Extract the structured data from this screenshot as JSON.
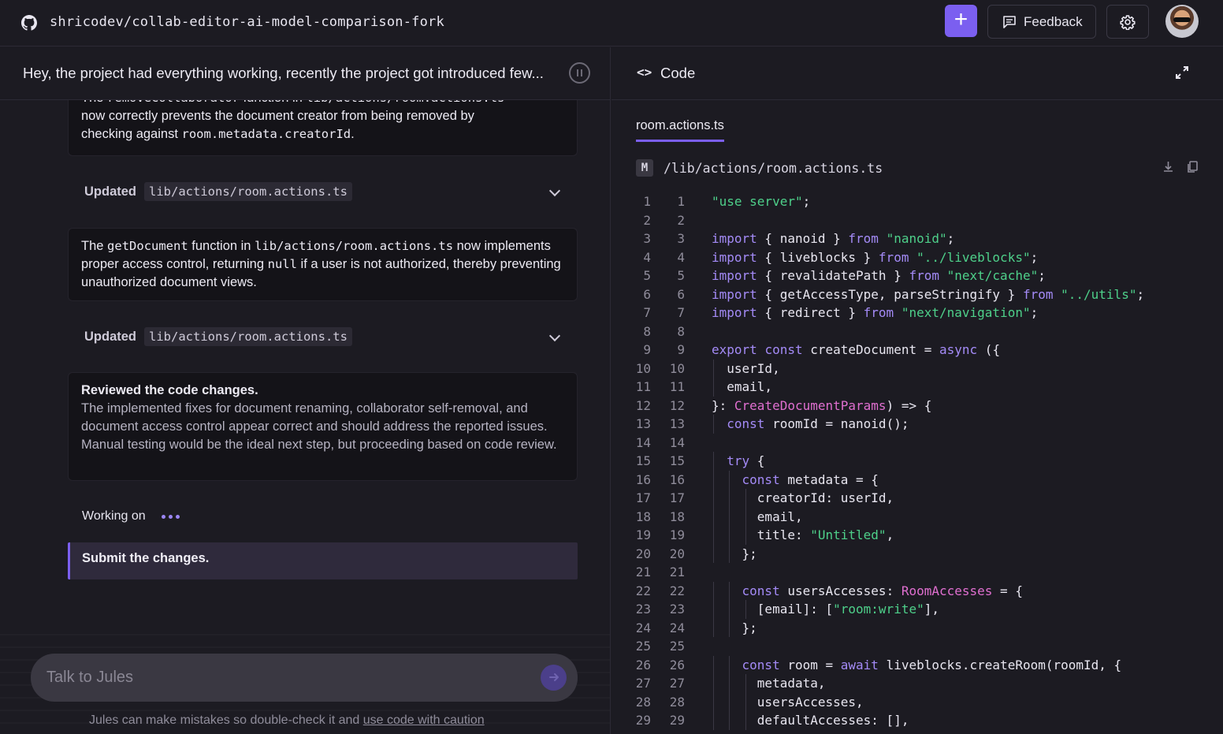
{
  "topbar": {
    "repo": "shricodev/collab-editor-ai-model-comparison-fork",
    "new_button_label": "+",
    "feedback_label": "Feedback"
  },
  "task": {
    "title": "Hey, the project had everything working, recently the project got introduced few..."
  },
  "messages": {
    "card1": {
      "line1_pre": "The ",
      "line1_code": "removeCollaborator",
      "line1_mid": " function in ",
      "line1_code2": "lib/actions/room.actions.ts",
      "line2": "now correctly prevents the document creator from being removed by",
      "line3_pre": "checking against ",
      "line3_code": "room.metadata.creatorId",
      "line3_post": "."
    },
    "updated1": {
      "label": "Updated",
      "file": "lib/actions/room.actions.ts"
    },
    "card2": {
      "pre": "The ",
      "code1": "getDocument",
      "mid": " function in ",
      "code2": "lib/actions/room.actions.ts",
      "post1": " now implements proper access control, returning ",
      "code3": "null",
      "post2": " if a user is not authorized, thereby preventing unauthorized document views."
    },
    "updated2": {
      "label": "Updated",
      "file": "lib/actions/room.actions.ts"
    },
    "card3": {
      "title": "Reviewed the code changes.",
      "body": "The implemented fixes for document renaming, collaborator self-removal, and document access control appear correct and should address the reported issues. Manual testing would be the ideal next step, but proceeding based on code review."
    },
    "working_label": "Working on",
    "submit_label": "Submit the changes."
  },
  "chat": {
    "placeholder": "Talk to Jules",
    "disclaimer_pre": "Jules can make mistakes so double-check it and ",
    "disclaimer_link": "use code with caution"
  },
  "code_panel": {
    "title": "Code",
    "code_icon": "<>",
    "file_tab": "room.actions.ts",
    "status_badge": "M",
    "file_path": "/lib/actions/room.actions.ts"
  },
  "code_lines": [
    {
      "n": "1",
      "indent": 0,
      "tokens": [
        [
          "str",
          "\"use server\""
        ],
        [
          "",
          ";"
        ]
      ]
    },
    {
      "n": "2",
      "indent": 0,
      "tokens": []
    },
    {
      "n": "3",
      "indent": 0,
      "tokens": [
        [
          "kw",
          "import"
        ],
        [
          "",
          " { nanoid } "
        ],
        [
          "kw",
          "from"
        ],
        [
          "",
          " "
        ],
        [
          "str",
          "\"nanoid\""
        ],
        [
          "",
          ";"
        ]
      ]
    },
    {
      "n": "4",
      "indent": 0,
      "tokens": [
        [
          "kw",
          "import"
        ],
        [
          "",
          " { liveblocks } "
        ],
        [
          "kw",
          "from"
        ],
        [
          "",
          " "
        ],
        [
          "str",
          "\"../liveblocks\""
        ],
        [
          "",
          ";"
        ]
      ]
    },
    {
      "n": "5",
      "indent": 0,
      "tokens": [
        [
          "kw",
          "import"
        ],
        [
          "",
          " { revalidatePath } "
        ],
        [
          "kw",
          "from"
        ],
        [
          "",
          " "
        ],
        [
          "str",
          "\"next/cache\""
        ],
        [
          "",
          ";"
        ]
      ]
    },
    {
      "n": "6",
      "indent": 0,
      "tokens": [
        [
          "kw",
          "import"
        ],
        [
          "",
          " { getAccessType, parseStringify } "
        ],
        [
          "kw",
          "from"
        ],
        [
          "",
          " "
        ],
        [
          "str",
          "\"../utils\""
        ],
        [
          "",
          ";"
        ]
      ]
    },
    {
      "n": "7",
      "indent": 0,
      "tokens": [
        [
          "kw",
          "import"
        ],
        [
          "",
          " { redirect } "
        ],
        [
          "kw",
          "from"
        ],
        [
          "",
          " "
        ],
        [
          "str",
          "\"next/navigation\""
        ],
        [
          "",
          ";"
        ]
      ]
    },
    {
      "n": "8",
      "indent": 0,
      "tokens": []
    },
    {
      "n": "9",
      "indent": 0,
      "tokens": [
        [
          "kw",
          "export"
        ],
        [
          "",
          " "
        ],
        [
          "kw",
          "const"
        ],
        [
          "",
          " createDocument = "
        ],
        [
          "kw",
          "async"
        ],
        [
          "",
          " ({"
        ]
      ]
    },
    {
      "n": "10",
      "indent": 1,
      "tokens": [
        [
          "",
          "userId,"
        ]
      ]
    },
    {
      "n": "11",
      "indent": 1,
      "tokens": [
        [
          "",
          "email,"
        ]
      ]
    },
    {
      "n": "12",
      "indent": 0,
      "tokens": [
        [
          "",
          "}: "
        ],
        [
          "typ",
          "CreateDocumentParams"
        ],
        [
          "",
          ") => {"
        ]
      ]
    },
    {
      "n": "13",
      "indent": 1,
      "tokens": [
        [
          "kw",
          "const"
        ],
        [
          "",
          " roomId = nanoid();"
        ]
      ]
    },
    {
      "n": "14",
      "indent": 0,
      "tokens": []
    },
    {
      "n": "15",
      "indent": 1,
      "tokens": [
        [
          "kw",
          "try"
        ],
        [
          "",
          " {"
        ]
      ]
    },
    {
      "n": "16",
      "indent": 2,
      "tokens": [
        [
          "kw",
          "const"
        ],
        [
          "",
          " metadata = {"
        ]
      ]
    },
    {
      "n": "17",
      "indent": 3,
      "tokens": [
        [
          "",
          "creatorId: userId,"
        ]
      ]
    },
    {
      "n": "18",
      "indent": 3,
      "tokens": [
        [
          "",
          "email,"
        ]
      ]
    },
    {
      "n": "19",
      "indent": 3,
      "tokens": [
        [
          "",
          "title: "
        ],
        [
          "str",
          "\"Untitled\""
        ],
        [
          "",
          ","
        ]
      ]
    },
    {
      "n": "20",
      "indent": 2,
      "tokens": [
        [
          "",
          "};"
        ]
      ]
    },
    {
      "n": "21",
      "indent": 0,
      "tokens": []
    },
    {
      "n": "22",
      "indent": 2,
      "tokens": [
        [
          "kw",
          "const"
        ],
        [
          "",
          " usersAccesses: "
        ],
        [
          "typ",
          "RoomAccesses"
        ],
        [
          "",
          " = {"
        ]
      ]
    },
    {
      "n": "23",
      "indent": 3,
      "tokens": [
        [
          "",
          "[email]: ["
        ],
        [
          "str",
          "\"room:write\""
        ],
        [
          "",
          "],"
        ]
      ]
    },
    {
      "n": "24",
      "indent": 2,
      "tokens": [
        [
          "",
          "};"
        ]
      ]
    },
    {
      "n": "25",
      "indent": 0,
      "tokens": []
    },
    {
      "n": "26",
      "indent": 2,
      "tokens": [
        [
          "kw",
          "const"
        ],
        [
          "",
          " room = "
        ],
        [
          "kw",
          "await"
        ],
        [
          "",
          " liveblocks.createRoom(roomId, {"
        ]
      ]
    },
    {
      "n": "27",
      "indent": 3,
      "tokens": [
        [
          "",
          "metadata,"
        ]
      ]
    },
    {
      "n": "28",
      "indent": 3,
      "tokens": [
        [
          "",
          "usersAccesses,"
        ]
      ]
    },
    {
      "n": "29",
      "indent": 3,
      "tokens": [
        [
          "",
          "defaultAccesses: [],"
        ]
      ]
    }
  ]
}
